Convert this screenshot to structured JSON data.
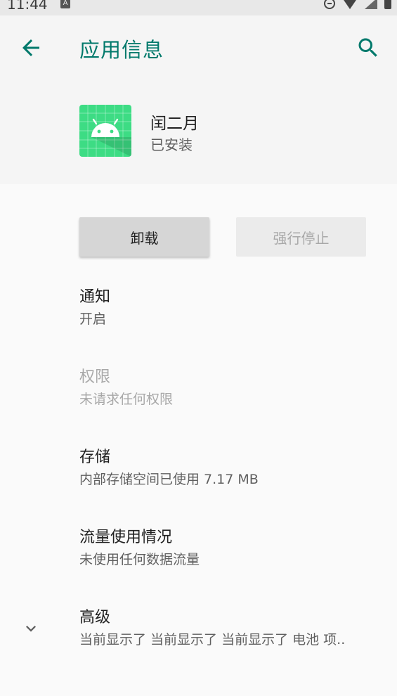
{
  "status_bar": {
    "time": "11:44",
    "badge": "A"
  },
  "header": {
    "title": "应用信息"
  },
  "app": {
    "name": "闰二月",
    "status": "已安装"
  },
  "buttons": {
    "uninstall": "卸载",
    "force_stop": "强行停止"
  },
  "items": [
    {
      "title": "通知",
      "summary": "开启",
      "enabled": true
    },
    {
      "title": "权限",
      "summary": "未请求任何权限",
      "enabled": false
    },
    {
      "title": "存储",
      "summary": "内部存储空间已使用 7.17 MB",
      "enabled": true
    },
    {
      "title": "流量使用情况",
      "summary": "未使用任何数据流量",
      "enabled": true
    },
    {
      "title": "高级",
      "summary": "当前显示了 当前显示了 当前显示了 电池 项..",
      "enabled": true
    }
  ],
  "colors": {
    "accent": "#00796b",
    "app_icon_bg": "#3ddc84",
    "status_bar_bg": "#e8e8e8"
  },
  "icons": {
    "back": "arrow-left-icon",
    "search": "search-icon",
    "expand": "chevron-down-icon"
  }
}
